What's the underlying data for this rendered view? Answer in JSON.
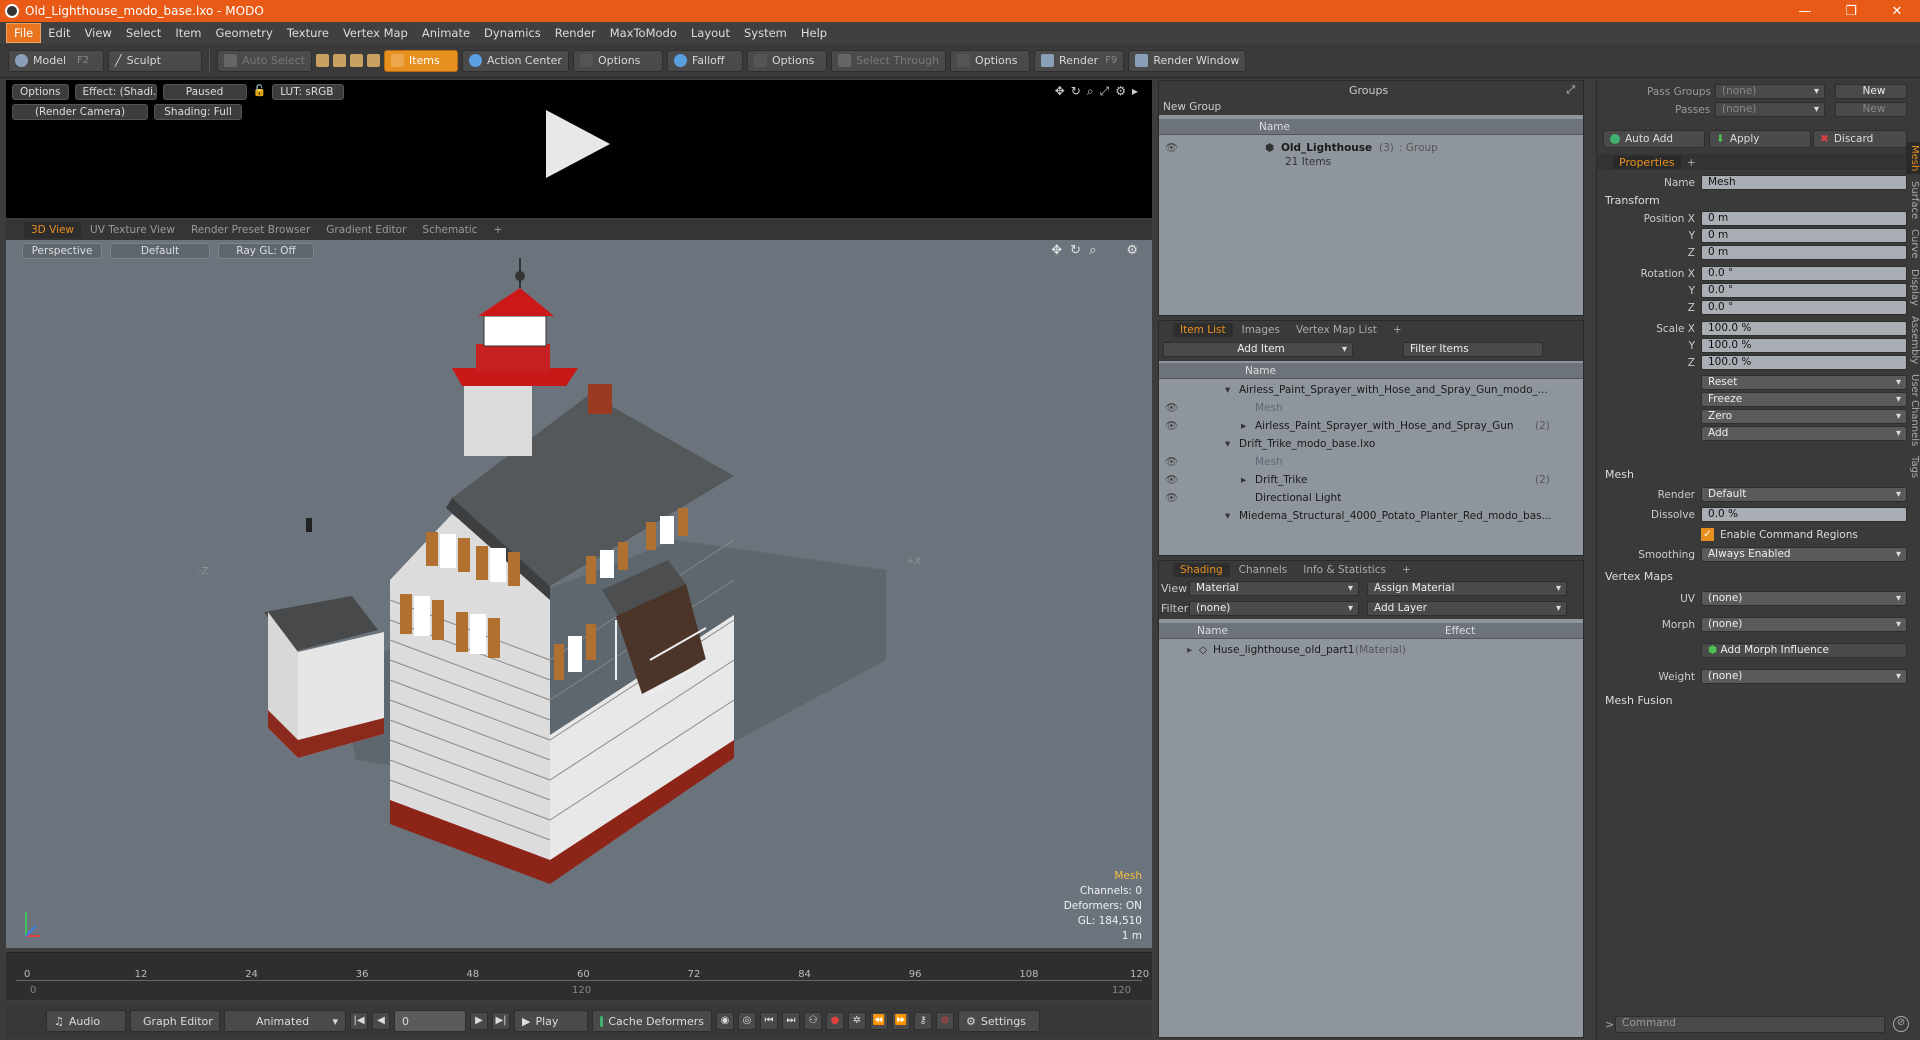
{
  "window": {
    "title": "Old_Lighthouse_modo_base.lxo - MODO"
  },
  "menu": [
    "File",
    "Edit",
    "View",
    "Select",
    "Item",
    "Geometry",
    "Texture",
    "Vertex Map",
    "Animate",
    "Dynamics",
    "Render",
    "MaxToModo",
    "Layout",
    "System",
    "Help"
  ],
  "toolbar": {
    "model": "Model",
    "model_key": "F2",
    "sculpt": "Sculpt",
    "auto_select": "Auto Select",
    "items": "Items",
    "action_center": "Action Center",
    "options1": "Options",
    "falloff": "Falloff",
    "options2": "Options",
    "select_through": "Select Through",
    "options3": "Options",
    "render": "Render",
    "render_key": "F9",
    "render_window": "Render Window"
  },
  "preview": {
    "options": "Options",
    "effect": "Effect: (Shadi...",
    "paused": "Paused",
    "lut": "LUT: sRGB",
    "camera": "(Render Camera)",
    "shading": "Shading: Full"
  },
  "view_tabs": [
    "3D View",
    "UV Texture View",
    "Render Preset Browser",
    "Gradient Editor",
    "Schematic"
  ],
  "viewport": {
    "perspective": "Perspective",
    "default": "Default",
    "raygl": "Ray GL: Off",
    "axis_neg_z": "-Z",
    "axis_pos_x": "+X",
    "info": {
      "type": "Mesh",
      "channels": "Channels: 0",
      "deformers": "Deformers: ON",
      "gl": "GL: 184,510",
      "scale": "1 m"
    }
  },
  "timeline": {
    "ticks": [
      "0",
      "12",
      "24",
      "36",
      "48",
      "60",
      "72",
      "84",
      "96",
      "108",
      "120"
    ],
    "sub_left": "0",
    "sub_mid": "120",
    "sub_right": "120"
  },
  "transport": {
    "audio": "Audio",
    "graph_editor": "Graph Editor",
    "animated": "Animated",
    "frame": "0",
    "play": "Play",
    "cache": "Cache Deformers",
    "settings": "Settings"
  },
  "groups": {
    "title": "Groups",
    "new_group": "New Group",
    "col_name": "Name",
    "group_name": "Old_Lighthouse",
    "group_count": "(3)",
    "group_type": ": Group",
    "group_items": "21 Items"
  },
  "item_list": {
    "tabs": [
      "Item List",
      "Images",
      "Vertex Map List"
    ],
    "add_item": "Add Item",
    "filter": "Filter Items",
    "col_name": "Name",
    "rows": [
      {
        "text": "Airless_Paint_Sprayer_with_Hose_and_Spray_Gun_modo_...",
        "extra": ""
      },
      {
        "text": "Mesh",
        "extra": ""
      },
      {
        "text": "Airless_Paint_Sprayer_with_Hose_and_Spray_Gun",
        "extra": "(2)"
      },
      {
        "text": "Drift_Trike_modo_base.lxo",
        "extra": ""
      },
      {
        "text": "Mesh",
        "extra": ""
      },
      {
        "text": "Drift_Trike",
        "extra": "(2)"
      },
      {
        "text": "Directional Light",
        "extra": ""
      },
      {
        "text": "Miedema_Structural_4000_Potato_Planter_Red_modo_bas...",
        "extra": ""
      }
    ]
  },
  "shading": {
    "tabs": [
      "Shading",
      "Channels",
      "Info & Statistics"
    ],
    "view_label": "View",
    "view_value": "Material",
    "assign": "Assign Material",
    "filter_label": "Filter",
    "filter_value": "(none)",
    "add_layer": "Add Layer",
    "col_name": "Name",
    "col_effect": "Effect",
    "material": "Huse_lighthouse_old_part1",
    "material_type": "(Material)"
  },
  "right": {
    "pass_groups": "Pass Groups",
    "passes": "Passes",
    "none": "(none)",
    "new": "New",
    "auto_add": "Auto Add",
    "apply": "Apply",
    "discard": "Discard",
    "properties": "Properties",
    "name_label": "Name",
    "name_value": "Mesh",
    "transform": "Transform",
    "position_x": "Position X",
    "y": "Y",
    "z": "Z",
    "pos": [
      "0 m",
      "0 m",
      "0 m"
    ],
    "rotation_x": "Rotation X",
    "rot": [
      "0.0 °",
      "0.0 °",
      "0.0 °"
    ],
    "scale_x": "Scale X",
    "scl": [
      "100.0 %",
      "100.0 %",
      "100.0 %"
    ],
    "reset": "Reset",
    "freeze": "Freeze",
    "zero": "Zero",
    "add": "Add",
    "mesh": "Mesh",
    "render_label": "Render",
    "render_value": "Default",
    "dissolve_label": "Dissolve",
    "dissolve_value": "0.0 %",
    "enable_cmd": "Enable Command Regions",
    "smoothing_label": "Smoothing",
    "smoothing_value": "Always Enabled",
    "vertex_maps": "Vertex Maps",
    "uv_label": "UV",
    "morph_label": "Morph",
    "map_none": "(none)",
    "add_morph": "Add Morph Influence",
    "weight_label": "Weight",
    "mesh_fusion": "Mesh Fusion",
    "side_tabs": [
      "Mesh",
      "Surface",
      "Curve",
      "Display",
      "Assembly",
      "User Channels",
      "Tags"
    ],
    "command": "Command"
  }
}
